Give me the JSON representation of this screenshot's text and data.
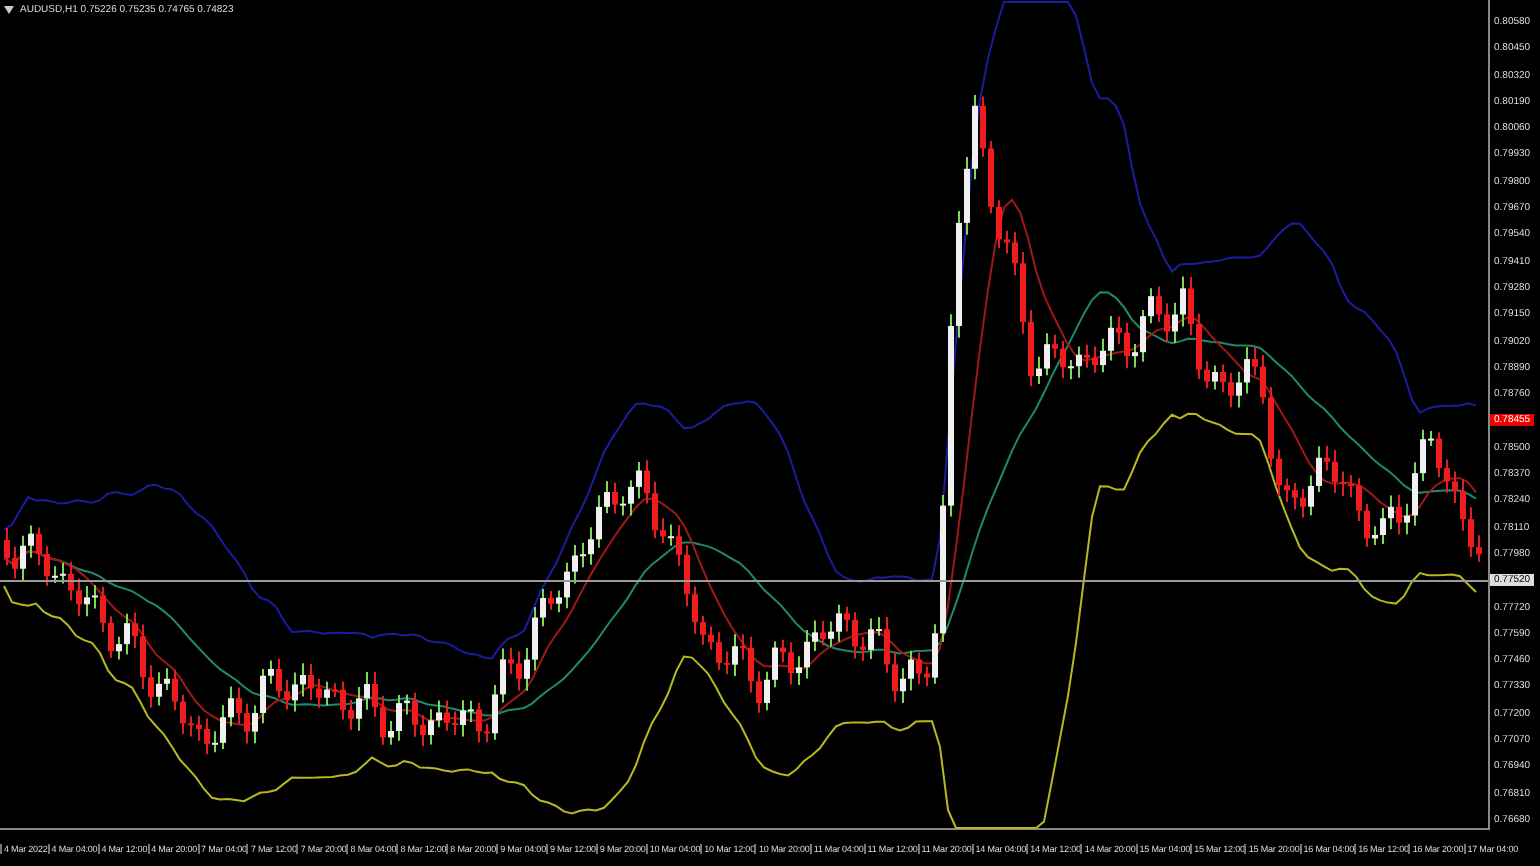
{
  "chart_title": "AUDUSD,H1  0.75226 0.75235 0.74765 0.74823",
  "price_labels": [
    {
      "kind": "tick",
      "text": "0.80580"
    },
    {
      "kind": "tick",
      "text": "0.80450"
    },
    {
      "kind": "tick",
      "text": "0.80320"
    },
    {
      "kind": "tick",
      "text": "0.80190"
    },
    {
      "kind": "tick",
      "text": "0.80060"
    },
    {
      "kind": "tick",
      "text": "0.79930"
    },
    {
      "kind": "tick",
      "text": "0.79800"
    },
    {
      "kind": "tick",
      "text": "0.79670"
    },
    {
      "kind": "tick",
      "text": "0.79540"
    },
    {
      "kind": "tick",
      "text": "0.79410"
    },
    {
      "kind": "tick",
      "text": "0.79280"
    },
    {
      "kind": "tick",
      "text": "0.79150"
    },
    {
      "kind": "tick",
      "text": "0.79020"
    },
    {
      "kind": "tick",
      "text": "0.78890"
    },
    {
      "kind": "tick",
      "text": "0.78760"
    },
    {
      "kind": "bid",
      "text": "0.78455"
    },
    {
      "kind": "tick",
      "text": "0.78500"
    },
    {
      "kind": "tick",
      "text": "0.78370"
    },
    {
      "kind": "tick",
      "text": "0.78240"
    },
    {
      "kind": "tick",
      "text": "0.78110"
    },
    {
      "kind": "tick",
      "text": "0.77980"
    },
    {
      "kind": "crosshair",
      "text": "0.77520"
    },
    {
      "kind": "tick",
      "text": "0.77720"
    },
    {
      "kind": "tick",
      "text": "0.77590"
    },
    {
      "kind": "tick",
      "text": "0.77460"
    },
    {
      "kind": "tick",
      "text": "0.77330"
    },
    {
      "kind": "tick",
      "text": "0.77200"
    },
    {
      "kind": "tick",
      "text": "0.77070"
    },
    {
      "kind": "tick",
      "text": "0.76940"
    },
    {
      "kind": "tick",
      "text": "0.76810"
    },
    {
      "kind": "tick",
      "text": "0.76680"
    }
  ],
  "time_labels": [
    "4 Mar 2022",
    "4 Mar 04:00",
    "4 Mar 12:00",
    "4 Mar 20:00",
    "7 Mar 04:00",
    "7 Mar 12:00",
    "7 Mar 20:00",
    "8 Mar 04:00",
    "8 Mar 12:00",
    "8 Mar 20:00",
    "9 Mar 04:00",
    "9 Mar 12:00",
    "9 Mar 20:00",
    "10 Mar 04:00",
    "10 Mar 12:00",
    "10 Mar 20:00",
    "11 Mar 04:00",
    "11 Mar 12:00",
    "11 Mar 20:00",
    "14 Mar 04:00",
    "14 Mar 12:00",
    "14 Mar 20:00",
    "15 Mar 04:00",
    "15 Mar 12:00",
    "15 Mar 20:00",
    "16 Mar 04:00",
    "16 Mar 12:00",
    "16 Mar 20:00",
    "17 Mar 04:00"
  ]
}
